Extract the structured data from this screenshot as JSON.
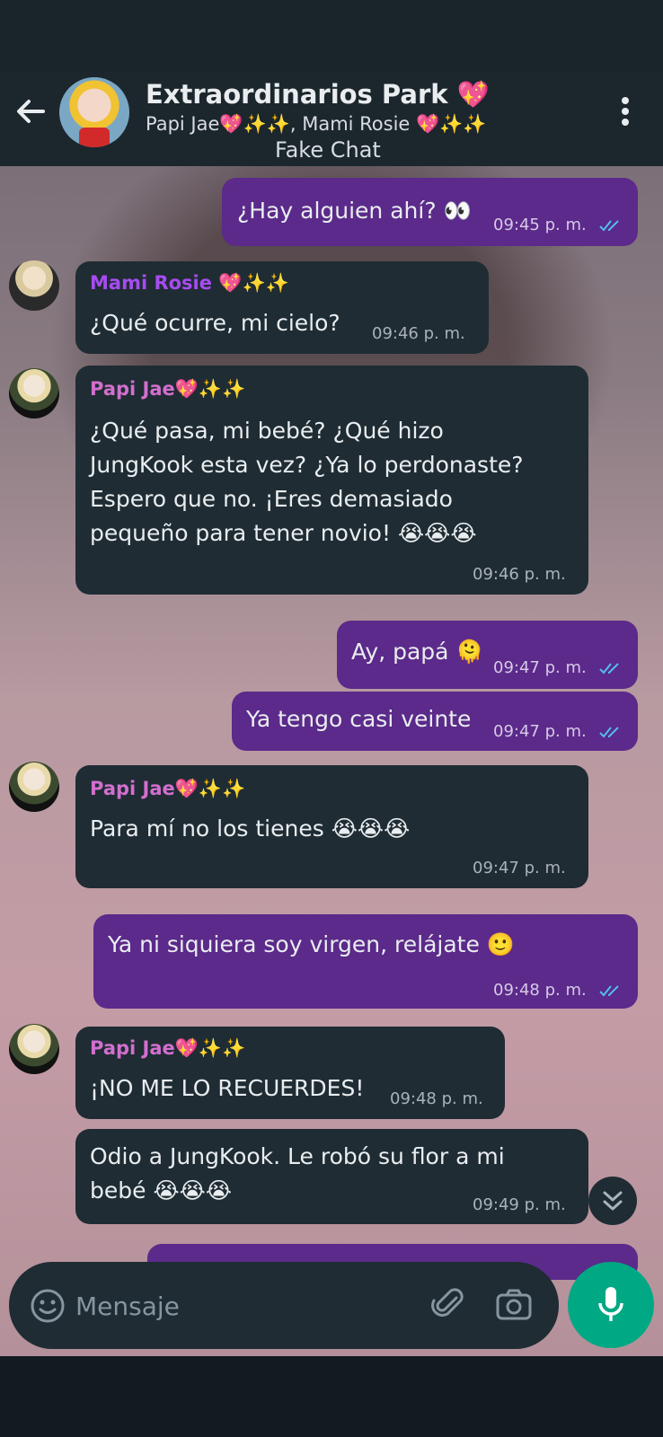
{
  "header": {
    "title": "Extraordinarios Park 💖",
    "subtitle": "Papi Jae💖✨✨, Mami Rosie 💖✨✨",
    "overlay_label": "Fake Chat"
  },
  "messages": [
    {
      "direction": "out",
      "text": "¿Hay alguien ahí? 👀",
      "time": "09:45 p. m.",
      "read": true
    },
    {
      "direction": "in",
      "sender": "Mami Rosie 💖✨✨",
      "text": "¿Qué ocurre, mi cielo?",
      "time": "09:46 p. m."
    },
    {
      "direction": "in",
      "sender": "Papi Jae💖✨✨",
      "lines": [
        "¿Qué pasa, mi bebé? ¿Qué hizo",
        "JungKook esta vez? ¿Ya lo perdonaste?",
        "Espero que no. ¡Eres demasiado",
        "pequeño para tener novio! 😭😭😭"
      ],
      "time": "09:46 p. m."
    },
    {
      "direction": "out",
      "text": "Ay, papá 🫠",
      "time": "09:47 p. m.",
      "read": true
    },
    {
      "direction": "out",
      "text": "Ya tengo casi veinte",
      "time": "09:47 p. m.",
      "read": true
    },
    {
      "direction": "in",
      "sender": "Papi Jae💖✨✨",
      "text": "Para mí no los tienes 😭😭😭",
      "time": "09:47 p. m."
    },
    {
      "direction": "out",
      "text": "Ya ni siquiera soy virgen, relájate 🙂",
      "time": "09:48 p. m.",
      "read": true
    },
    {
      "direction": "in",
      "sender": "Papi Jae💖✨✨",
      "text": "¡NO ME LO RECUERDES!",
      "time": "09:48 p. m."
    },
    {
      "direction": "in",
      "lines": [
        "Odio a JungKook. Le robó su flor a mi",
        "bebé 😭😭😭"
      ],
      "time": "09:49 p. m."
    }
  ],
  "composer": {
    "placeholder": "Mensaje",
    "icons": [
      "emoji-icon",
      "paperclip-icon",
      "camera-icon",
      "mic-icon"
    ]
  },
  "colors": {
    "outgoing_bubble": "#5b2a8a",
    "incoming_bubble": "#1f2c33",
    "read_ticks": "#53bdeb",
    "mic_button": "#00a884"
  }
}
